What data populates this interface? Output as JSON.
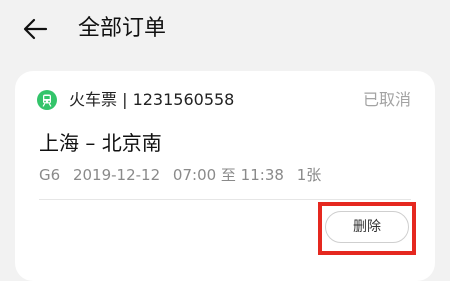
{
  "header": {
    "title": "全部订单",
    "back_icon": "arrow-left-icon"
  },
  "order": {
    "type_icon": "train-icon",
    "type_icon_color": "#33c46a",
    "type_line": "火车票 | 1231560558",
    "status": "已取消",
    "route": "上海 – 北京南",
    "train_number": "G6",
    "date": "2019-12-12",
    "time_range": "07:00 至 11:38",
    "tickets": "1张",
    "delete_label": "删除",
    "highlight_color": "#e5281f"
  }
}
